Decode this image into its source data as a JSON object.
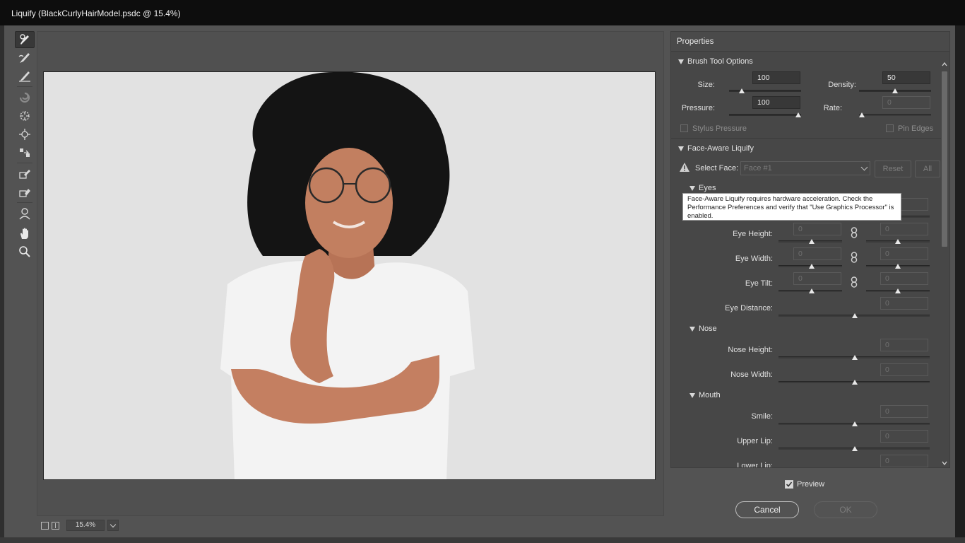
{
  "window": {
    "title": "Liquify (BlackCurlyHairModel.psdc @ 15.4%)"
  },
  "tools": [
    {
      "name": "forward-warp-tool-icon",
      "active": true
    },
    {
      "name": "reconstruct-tool-icon"
    },
    {
      "name": "smooth-tool-icon"
    },
    {
      "name": "twirl-clockwise-tool-icon"
    },
    {
      "name": "pucker-tool-icon"
    },
    {
      "name": "bloat-tool-icon"
    },
    {
      "name": "push-left-tool-icon"
    },
    {
      "name": "freeze-mask-tool-icon"
    },
    {
      "name": "thaw-mask-tool-icon"
    },
    {
      "name": "face-tool-icon"
    },
    {
      "name": "hand-tool-icon"
    },
    {
      "name": "zoom-tool-icon"
    }
  ],
  "canvas": {
    "zoom": "15.4%"
  },
  "properties": {
    "title": "Properties",
    "brush": {
      "heading": "Brush Tool Options",
      "size_label": "Size:",
      "size_value": "100",
      "size_level": 0.15,
      "density_label": "Density:",
      "density_value": "50",
      "density_level": 0.5,
      "pressure_label": "Pressure:",
      "pressure_value": "100",
      "pressure_level": 1.0,
      "rate_label": "Rate:",
      "rate_value": "0",
      "rate_level": 0.0,
      "stylus_label": "Stylus Pressure",
      "pin_label": "Pin Edges"
    },
    "face": {
      "heading": "Face-Aware Liquify",
      "select_face_label": "Select Face:",
      "select_face_value": "Face #1",
      "reset_label": "Reset",
      "all_label": "All",
      "tooltip": "Face-Aware Liquify requires hardware acceleration. Check the Performance Preferences and verify that \"Use Graphics Processor\" is enabled.",
      "eyes_heading": "Eyes",
      "eye_height_label": "Eye Height:",
      "eye_width_label": "Eye Width:",
      "eye_tilt_label": "Eye Tilt:",
      "eye_distance_label": "Eye Distance:",
      "nose_heading": "Nose",
      "nose_height_label": "Nose Height:",
      "nose_width_label": "Nose Width:",
      "mouth_heading": "Mouth",
      "smile_label": "Smile:",
      "upper_lip_label": "Upper Lip:",
      "lower_lip_label": "Lower Lip:",
      "zero": "0"
    }
  },
  "footer": {
    "preview_label": "Preview",
    "cancel_label": "Cancel",
    "ok_label": "OK"
  }
}
